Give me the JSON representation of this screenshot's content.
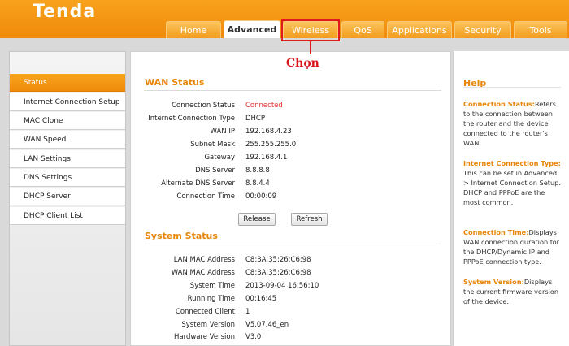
{
  "brand": {
    "logo": "Tenda"
  },
  "nav": {
    "tabs": [
      "Home",
      "Advanced",
      "Wireless",
      "QoS",
      "Applications",
      "Security",
      "Tools"
    ],
    "active": "Advanced"
  },
  "annotation": {
    "text": "Chọn"
  },
  "sidebar": {
    "items": [
      "Status",
      "Internet Connection Setup",
      "MAC Clone",
      "WAN Speed",
      "LAN Settings",
      "DNS Settings",
      "DHCP Server",
      "DHCP Client List"
    ],
    "active": "Status"
  },
  "wan": {
    "title": "WAN Status",
    "rows": [
      {
        "label": "Connection Status",
        "value": "Connected"
      },
      {
        "label": "Internet Connection Type",
        "value": "DHCP"
      },
      {
        "label": "WAN IP",
        "value": "192.168.4.23"
      },
      {
        "label": "Subnet Mask",
        "value": "255.255.255.0"
      },
      {
        "label": "Gateway",
        "value": "192.168.4.1"
      },
      {
        "label": "DNS Server",
        "value": "8.8.8.8"
      },
      {
        "label": "Alternate DNS Server",
        "value": "8.8.4.4"
      },
      {
        "label": "Connection Time",
        "value": "00:00:09"
      }
    ],
    "release_label": "Release",
    "refresh_label": "Refresh"
  },
  "system": {
    "title": "System Status",
    "rows": [
      {
        "label": "LAN MAC Address",
        "value": "C8:3A:35:26:C6:98"
      },
      {
        "label": "WAN MAC Address",
        "value": "C8:3A:35:26:C6:98"
      },
      {
        "label": "System Time",
        "value": "2013-09-04 16:56:10"
      },
      {
        "label": "Running Time",
        "value": "00:16:45"
      },
      {
        "label": "Connected Client",
        "value": "1"
      },
      {
        "label": "System Version",
        "value": "V5.07.46_en"
      },
      {
        "label": "Hardware Version",
        "value": "V3.0"
      }
    ]
  },
  "help": {
    "title": "Help",
    "blocks": [
      {
        "heading": "Connection Status:",
        "text": "Refers to the connection between the router and the device connected to the router's WAN."
      },
      {
        "heading": "Internet Connection Type:",
        "text": "This can be set in Advanced > Internet Connection Setup. DHCP and PPPoE are the most common."
      },
      {
        "heading": "Connection Time:",
        "text": "Displays WAN connection duration for the DHCP/Dynamic IP and PPPoE connection type."
      },
      {
        "heading": "System Version:",
        "text": "Displays the current firmware version of the device."
      }
    ]
  },
  "colors": {
    "brand_orange": "#f29c1c",
    "accent_text": "#e8860a",
    "highlight_red": "#e0191e"
  }
}
